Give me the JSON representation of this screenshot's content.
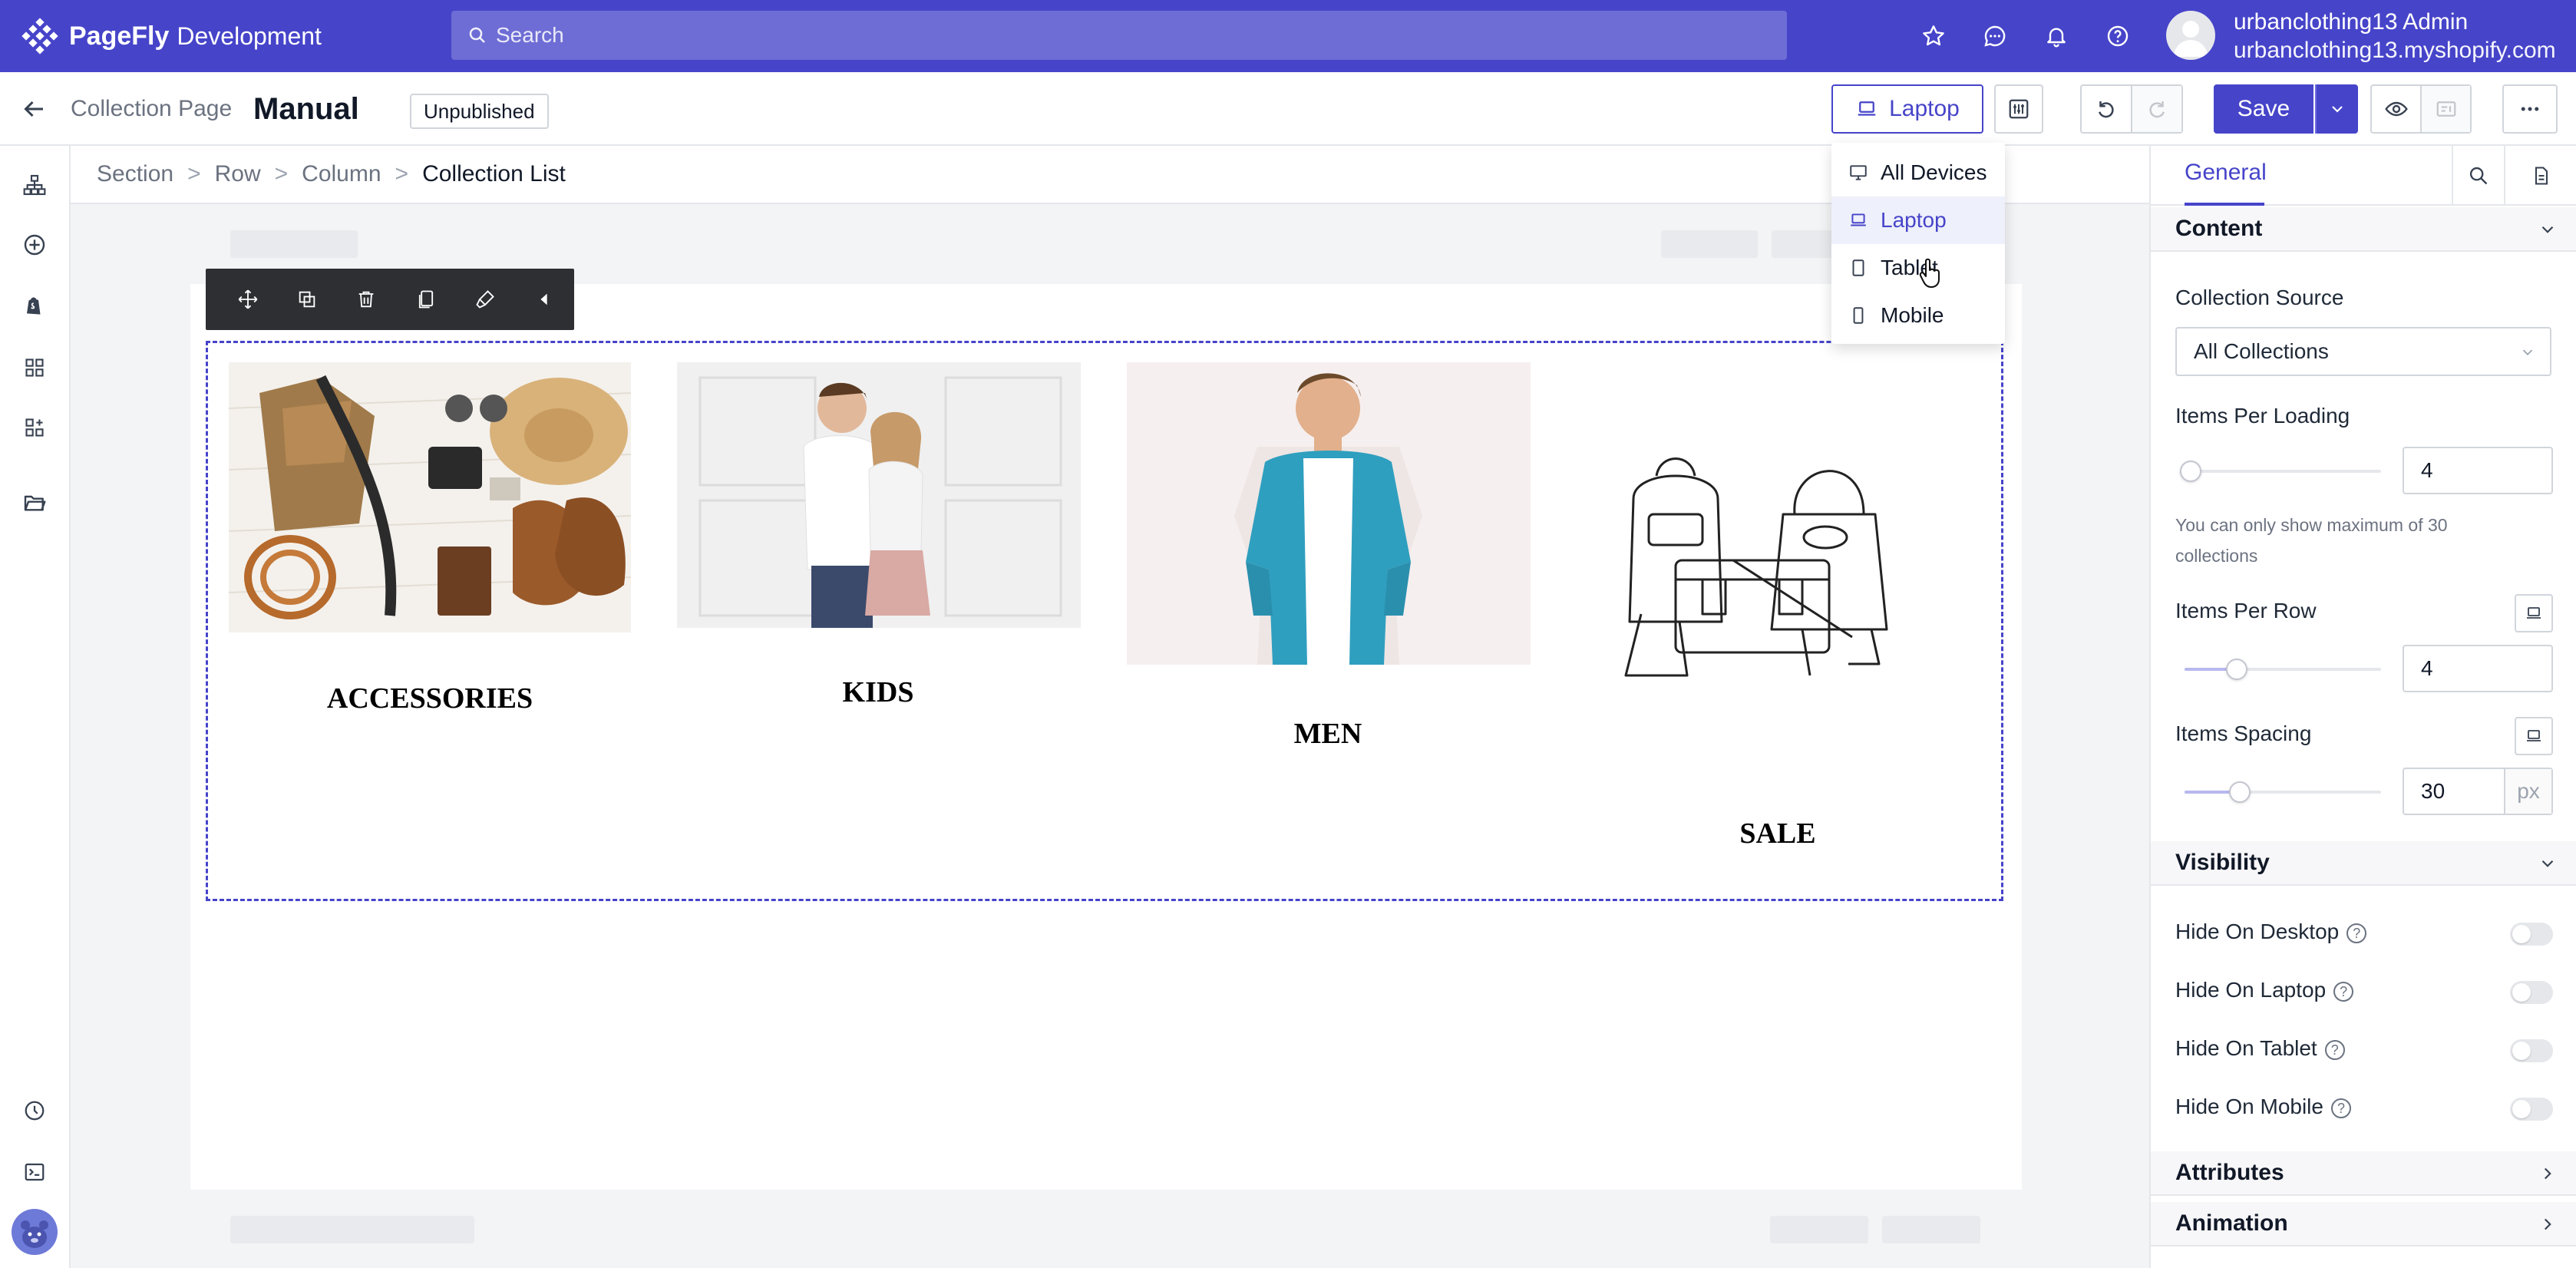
{
  "topbar": {
    "brand": "PageFly",
    "brand_sub": "Development",
    "search_placeholder": "Search",
    "account_name": "urbanclothing13 Admin",
    "account_domain": "urbanclothing13.myshopify.com",
    "colors": {
      "primary": "#4644c9"
    }
  },
  "editor_bar": {
    "page_type": "Collection Page",
    "page_title": "Manual",
    "status_badge": "Unpublished",
    "device_selected": "Laptop",
    "save_label": "Save"
  },
  "breadcrumb": [
    "Section",
    "Row",
    "Column",
    "Collection List"
  ],
  "breadcrumb_sep": ">",
  "device_menu": [
    {
      "label": "All Devices",
      "icon": "desktop-icon",
      "active": false
    },
    {
      "label": "Laptop",
      "icon": "laptop-icon",
      "active": true
    },
    {
      "label": "Tablet",
      "icon": "tablet-icon",
      "active": false
    },
    {
      "label": "Mobile",
      "icon": "mobile-icon",
      "active": false
    }
  ],
  "collections": [
    {
      "label": "ACCESSORIES"
    },
    {
      "label": "KIDS"
    },
    {
      "label": "MEN"
    },
    {
      "label": "SALE"
    }
  ],
  "panel": {
    "tab_general": "General",
    "content": {
      "title": "Content",
      "collection_source_label": "Collection Source",
      "collection_source_value": "All Collections",
      "items_per_loading_label": "Items Per Loading",
      "items_per_loading_value": "4",
      "help_line1": "You can only show maximum of 30",
      "help_line2": "collections",
      "items_per_row_label": "Items Per Row",
      "items_per_row_value": "4",
      "items_spacing_label": "Items Spacing",
      "items_spacing_value": "30",
      "items_spacing_unit": "px"
    },
    "visibility": {
      "title": "Visibility",
      "hide_desktop": "Hide On Desktop",
      "hide_laptop": "Hide On Laptop",
      "hide_tablet": "Hide On Tablet",
      "hide_mobile": "Hide On Mobile"
    },
    "attributes_title": "Attributes",
    "animation_title": "Animation"
  }
}
